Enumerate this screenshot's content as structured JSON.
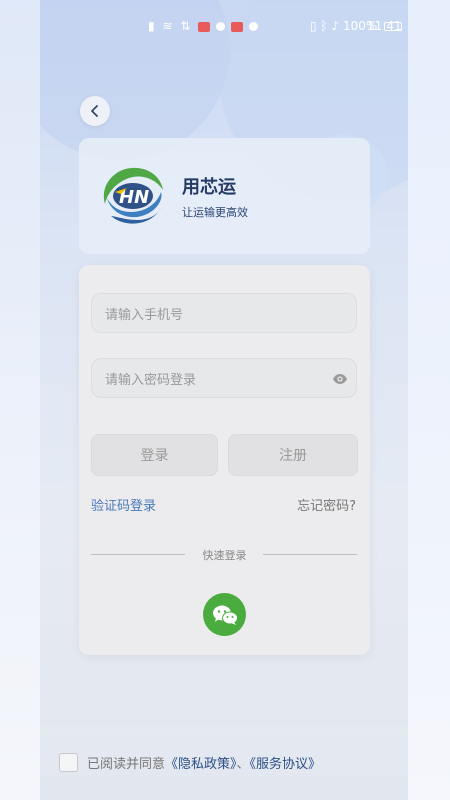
{
  "status_bar": {
    "battery_text": "100%",
    "time": "11:41"
  },
  "header": {
    "back_icon": "chevron-left-icon"
  },
  "brand": {
    "app_name": "用芯运",
    "slogan": "让运输更高效"
  },
  "form": {
    "phone_placeholder": "请输入手机号",
    "password_placeholder": "请输入密码登录",
    "eye_icon": "eye-icon"
  },
  "buttons": {
    "login": "登录",
    "register": "注册"
  },
  "links": {
    "sms_login": "验证码登录",
    "forgot_password": "忘记密码?"
  },
  "quick_login": {
    "label": "快速登录",
    "wechat_icon": "wechat-icon"
  },
  "agreement": {
    "prefix": "已阅读并同意",
    "privacy": "《隐私政策》",
    "separator": "、",
    "service": "《服务协议》"
  },
  "colors": {
    "accent_link": "#4a78b8",
    "wechat_green": "#4aab3f",
    "brand_text": "#263a66"
  }
}
